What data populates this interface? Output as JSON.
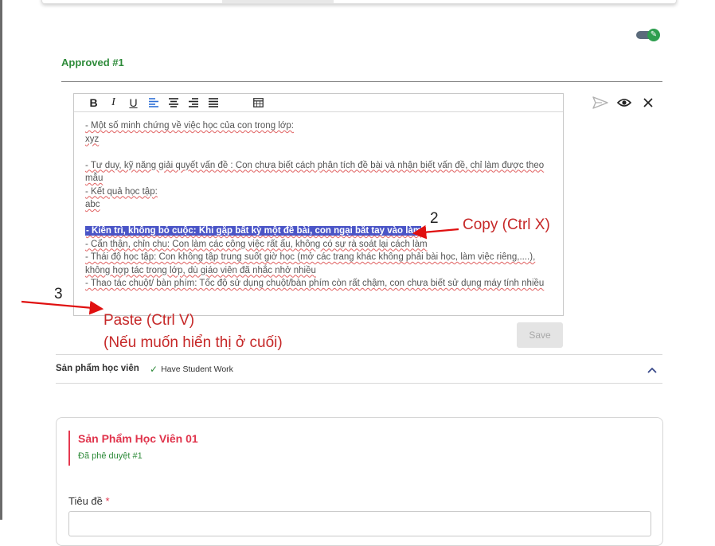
{
  "top_tabs": {},
  "toggle": {
    "state": "on",
    "icon": "pencil-icon",
    "color": "#2e9e4f"
  },
  "approved_section": {
    "title": "Approved #1"
  },
  "editor": {
    "toolbar": {
      "bold": "B",
      "italic": "I",
      "underline": "U",
      "align_left": "align-left-icon",
      "align_center": "align-center-icon",
      "align_right": "align-right-icon",
      "align_justify": "align-justify-icon",
      "table": "table-icon"
    },
    "lines": [
      "- Một số minh chứng về việc học của con trong lớp:",
      "xyz",
      "",
      "- Tư duy, kỹ năng giải quyết vấn đề : Con chưa biết cách phân tích đề bài và nhận biết vấn đề, chỉ làm được theo mẫu",
      "- Kết quả học tập:",
      "abc",
      "",
      "- Kiên trì, không bỏ cuộc: Khi gặp bất kỳ một đề bài, con ngại bắt tay vào làm",
      "- Cẩn thận, chỉn chu: Con làm các công việc rất ẩu, không có sự rà soát lại cách làm",
      "- Thái độ học tập: Con không tập trung suốt giờ học (mở các trang khác không phải bài học, làm việc riêng,....), không hợp tác trong lớp, dù giáo viên đã nhắc nhở nhiều",
      "- Thao tác chuột/ bàn phím: Tốc độ sử dụng chuột/bàn phím còn rất chậm, con chưa biết sử dụng máy tính nhiều"
    ],
    "highlight_color": "#4a55c7",
    "save_label": "Save"
  },
  "side_actions": {
    "send": "send-icon",
    "preview": "eye-icon",
    "close": "close-icon"
  },
  "annotations": {
    "copy_number": "2",
    "copy_text": "Copy (Ctrl X)",
    "paste_number": "3",
    "paste_text_1": "Paste (Ctrl V)",
    "paste_text_2": "(Nếu muốn hiển thị ở cuối)",
    "color": "#c62828"
  },
  "product_section": {
    "label": "Sản phẩm học viên",
    "status": "Have Student Work"
  },
  "product_card": {
    "title": "Sản Phẩm Học Viên 01",
    "subtitle": "Đã phê duyệt #1",
    "field_label": "Tiêu đề",
    "required_mark": "*"
  }
}
